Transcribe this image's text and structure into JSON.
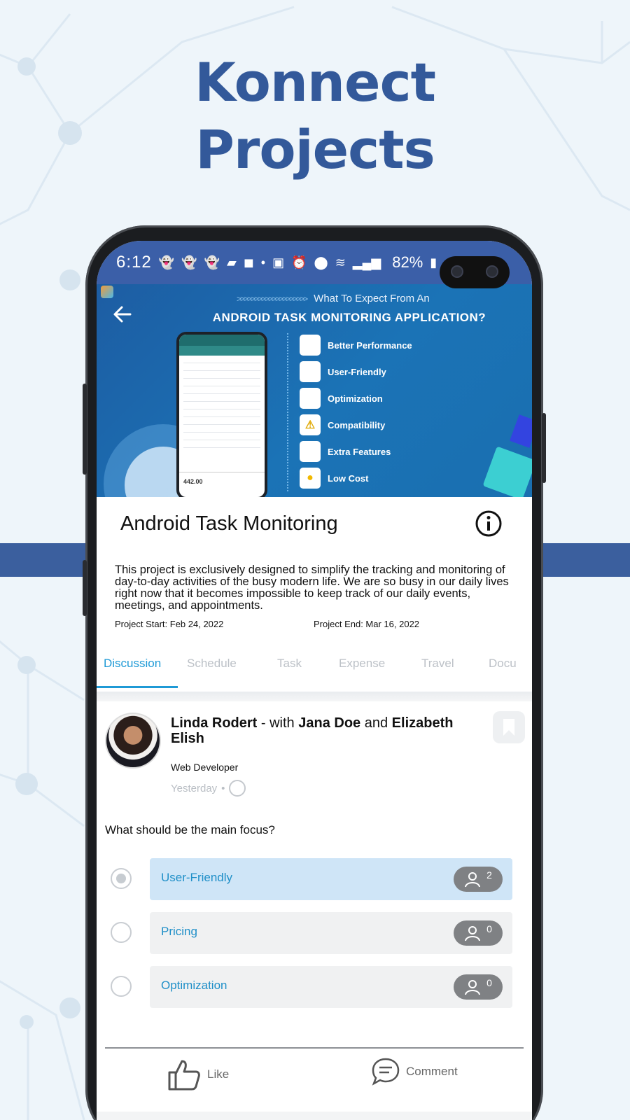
{
  "headline": {
    "line1": "Konnect",
    "line2": "Projects"
  },
  "status_bar": {
    "time": "6:12",
    "battery": "82%",
    "icons": [
      "snapchat-icon",
      "snapchat-icon",
      "snapchat-icon",
      "message-icon",
      "facebook-icon",
      "dot-icon",
      "battery-saver-icon",
      "alarm-icon",
      "location-icon",
      "wifi-icon",
      "signal-icon",
      "signal-icon",
      "battery-icon"
    ]
  },
  "banner": {
    "subtitle": "What To Expect From An",
    "title": "ANDROID TASK MONITORING APPLICATION?",
    "mini_total": "442.00",
    "features": [
      {
        "label": "Better Performance",
        "icon": "speedometer-icon"
      },
      {
        "label": "User-Friendly",
        "icon": "phone-user-icon"
      },
      {
        "label": "Optimization",
        "icon": "chart-icon"
      },
      {
        "label": "Compatibility",
        "icon": "warning-icon"
      },
      {
        "label": "Extra Features",
        "icon": "screen-icon"
      },
      {
        "label": "Low Cost",
        "icon": "bulb-icon"
      }
    ]
  },
  "project": {
    "title": "Android Task Monitoring",
    "description": "This project is exclusively designed to simplify the tracking and monitoring of day-to-day activities of the busy modern life. We are so busy in our daily lives right now that it becomes impossible to keep track of our daily events, meetings, and appointments.",
    "start": "Project Start: Feb 24, 2022",
    "end": "Project End: Mar 16, 2022"
  },
  "tabs": [
    "Discussion",
    "Schedule",
    "Task",
    "Expense",
    "Travel",
    "Docu"
  ],
  "active_tab": "Discussion",
  "post": {
    "author": "Linda Rodert",
    "with_text": " - with ",
    "mention1": "Jana Doe",
    "and_text": " and ",
    "mention2": "Elizabeth Elish",
    "role": "Web Developer",
    "time": "Yesterday",
    "time_sep": "•",
    "question": "What should be the main focus?",
    "options": [
      {
        "label": "User-Friendly",
        "count": "2",
        "selected": true
      },
      {
        "label": "Pricing",
        "count": "0",
        "selected": false
      },
      {
        "label": "Optimization",
        "count": "0",
        "selected": false
      }
    ],
    "like_label": "Like",
    "comment_label": "Comment"
  },
  "colors": {
    "headline": "#33599a",
    "band": "#3b5f9e",
    "accent": "#1f9ad6",
    "selected_option": "#cfe5f7"
  }
}
